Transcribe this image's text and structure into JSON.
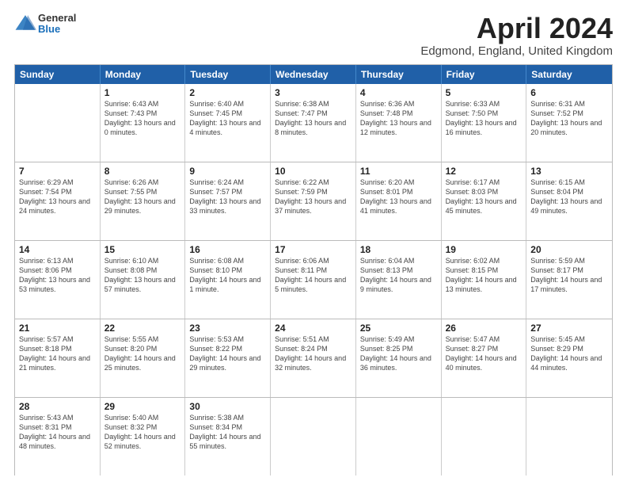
{
  "logo": {
    "general": "General",
    "blue": "Blue"
  },
  "title": "April 2024",
  "subtitle": "Edgmond, England, United Kingdom",
  "header_days": [
    "Sunday",
    "Monday",
    "Tuesday",
    "Wednesday",
    "Thursday",
    "Friday",
    "Saturday"
  ],
  "weeks": [
    [
      {
        "day": "",
        "sunrise": "",
        "sunset": "",
        "daylight": ""
      },
      {
        "day": "1",
        "sunrise": "Sunrise: 6:43 AM",
        "sunset": "Sunset: 7:43 PM",
        "daylight": "Daylight: 13 hours and 0 minutes."
      },
      {
        "day": "2",
        "sunrise": "Sunrise: 6:40 AM",
        "sunset": "Sunset: 7:45 PM",
        "daylight": "Daylight: 13 hours and 4 minutes."
      },
      {
        "day": "3",
        "sunrise": "Sunrise: 6:38 AM",
        "sunset": "Sunset: 7:47 PM",
        "daylight": "Daylight: 13 hours and 8 minutes."
      },
      {
        "day": "4",
        "sunrise": "Sunrise: 6:36 AM",
        "sunset": "Sunset: 7:48 PM",
        "daylight": "Daylight: 13 hours and 12 minutes."
      },
      {
        "day": "5",
        "sunrise": "Sunrise: 6:33 AM",
        "sunset": "Sunset: 7:50 PM",
        "daylight": "Daylight: 13 hours and 16 minutes."
      },
      {
        "day": "6",
        "sunrise": "Sunrise: 6:31 AM",
        "sunset": "Sunset: 7:52 PM",
        "daylight": "Daylight: 13 hours and 20 minutes."
      }
    ],
    [
      {
        "day": "7",
        "sunrise": "Sunrise: 6:29 AM",
        "sunset": "Sunset: 7:54 PM",
        "daylight": "Daylight: 13 hours and 24 minutes."
      },
      {
        "day": "8",
        "sunrise": "Sunrise: 6:26 AM",
        "sunset": "Sunset: 7:55 PM",
        "daylight": "Daylight: 13 hours and 29 minutes."
      },
      {
        "day": "9",
        "sunrise": "Sunrise: 6:24 AM",
        "sunset": "Sunset: 7:57 PM",
        "daylight": "Daylight: 13 hours and 33 minutes."
      },
      {
        "day": "10",
        "sunrise": "Sunrise: 6:22 AM",
        "sunset": "Sunset: 7:59 PM",
        "daylight": "Daylight: 13 hours and 37 minutes."
      },
      {
        "day": "11",
        "sunrise": "Sunrise: 6:20 AM",
        "sunset": "Sunset: 8:01 PM",
        "daylight": "Daylight: 13 hours and 41 minutes."
      },
      {
        "day": "12",
        "sunrise": "Sunrise: 6:17 AM",
        "sunset": "Sunset: 8:03 PM",
        "daylight": "Daylight: 13 hours and 45 minutes."
      },
      {
        "day": "13",
        "sunrise": "Sunrise: 6:15 AM",
        "sunset": "Sunset: 8:04 PM",
        "daylight": "Daylight: 13 hours and 49 minutes."
      }
    ],
    [
      {
        "day": "14",
        "sunrise": "Sunrise: 6:13 AM",
        "sunset": "Sunset: 8:06 PM",
        "daylight": "Daylight: 13 hours and 53 minutes."
      },
      {
        "day": "15",
        "sunrise": "Sunrise: 6:10 AM",
        "sunset": "Sunset: 8:08 PM",
        "daylight": "Daylight: 13 hours and 57 minutes."
      },
      {
        "day": "16",
        "sunrise": "Sunrise: 6:08 AM",
        "sunset": "Sunset: 8:10 PM",
        "daylight": "Daylight: 14 hours and 1 minute."
      },
      {
        "day": "17",
        "sunrise": "Sunrise: 6:06 AM",
        "sunset": "Sunset: 8:11 PM",
        "daylight": "Daylight: 14 hours and 5 minutes."
      },
      {
        "day": "18",
        "sunrise": "Sunrise: 6:04 AM",
        "sunset": "Sunset: 8:13 PM",
        "daylight": "Daylight: 14 hours and 9 minutes."
      },
      {
        "day": "19",
        "sunrise": "Sunrise: 6:02 AM",
        "sunset": "Sunset: 8:15 PM",
        "daylight": "Daylight: 14 hours and 13 minutes."
      },
      {
        "day": "20",
        "sunrise": "Sunrise: 5:59 AM",
        "sunset": "Sunset: 8:17 PM",
        "daylight": "Daylight: 14 hours and 17 minutes."
      }
    ],
    [
      {
        "day": "21",
        "sunrise": "Sunrise: 5:57 AM",
        "sunset": "Sunset: 8:18 PM",
        "daylight": "Daylight: 14 hours and 21 minutes."
      },
      {
        "day": "22",
        "sunrise": "Sunrise: 5:55 AM",
        "sunset": "Sunset: 8:20 PM",
        "daylight": "Daylight: 14 hours and 25 minutes."
      },
      {
        "day": "23",
        "sunrise": "Sunrise: 5:53 AM",
        "sunset": "Sunset: 8:22 PM",
        "daylight": "Daylight: 14 hours and 29 minutes."
      },
      {
        "day": "24",
        "sunrise": "Sunrise: 5:51 AM",
        "sunset": "Sunset: 8:24 PM",
        "daylight": "Daylight: 14 hours and 32 minutes."
      },
      {
        "day": "25",
        "sunrise": "Sunrise: 5:49 AM",
        "sunset": "Sunset: 8:25 PM",
        "daylight": "Daylight: 14 hours and 36 minutes."
      },
      {
        "day": "26",
        "sunrise": "Sunrise: 5:47 AM",
        "sunset": "Sunset: 8:27 PM",
        "daylight": "Daylight: 14 hours and 40 minutes."
      },
      {
        "day": "27",
        "sunrise": "Sunrise: 5:45 AM",
        "sunset": "Sunset: 8:29 PM",
        "daylight": "Daylight: 14 hours and 44 minutes."
      }
    ],
    [
      {
        "day": "28",
        "sunrise": "Sunrise: 5:43 AM",
        "sunset": "Sunset: 8:31 PM",
        "daylight": "Daylight: 14 hours and 48 minutes."
      },
      {
        "day": "29",
        "sunrise": "Sunrise: 5:40 AM",
        "sunset": "Sunset: 8:32 PM",
        "daylight": "Daylight: 14 hours and 52 minutes."
      },
      {
        "day": "30",
        "sunrise": "Sunrise: 5:38 AM",
        "sunset": "Sunset: 8:34 PM",
        "daylight": "Daylight: 14 hours and 55 minutes."
      },
      {
        "day": "",
        "sunrise": "",
        "sunset": "",
        "daylight": ""
      },
      {
        "day": "",
        "sunrise": "",
        "sunset": "",
        "daylight": ""
      },
      {
        "day": "",
        "sunrise": "",
        "sunset": "",
        "daylight": ""
      },
      {
        "day": "",
        "sunrise": "",
        "sunset": "",
        "daylight": ""
      }
    ]
  ]
}
